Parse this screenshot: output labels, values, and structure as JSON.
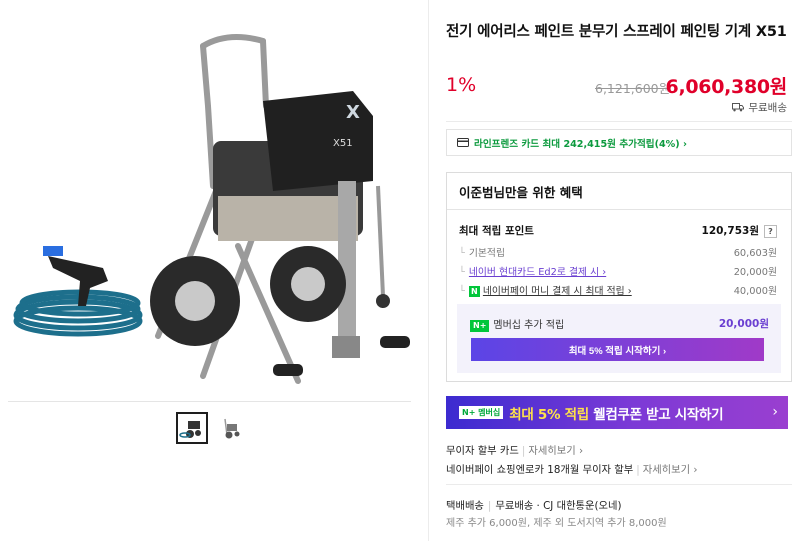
{
  "product": {
    "title": "전기 에어리스 페인트 분무기 스프레이 페인팅 기계 X51",
    "model_badge": "X51",
    "discount": "1%",
    "original_price": "6,121,600원",
    "sale_price": "6,060,380원",
    "shipping_tag": "무료배송"
  },
  "card_promo": {
    "text": "라인프렌즈 카드 최대 242,415원 추가적립(4%) ›"
  },
  "benefits": {
    "heading": "이준범님만을 위한 혜택",
    "max_label": "최대 적립 포인트",
    "max_value": "120,753원",
    "help": "?",
    "rows": [
      {
        "label": "기본적립",
        "value": "60,603원"
      },
      {
        "label": "네이버 현대카드 Ed2로 결제 시 ›",
        "value": "20,000원"
      },
      {
        "label": "네이버페이 머니 결제 시 최대 적립 ›",
        "value": "40,000원",
        "badge": "N"
      }
    ],
    "membership": {
      "badge": "N+",
      "label": "멤버십 추가 적립",
      "value": "20,000원",
      "button": "최대 5% 적립 시작하기 ›"
    }
  },
  "banner": {
    "badge": "N+ 멤버십",
    "text_highlight": "최대 5% 적립",
    "text_rest": " 웰컴쿠폰 받고 시작하기",
    "chevron": "›"
  },
  "payment": {
    "line1_label": "무이자 할부 카드",
    "line1_more": "자세히보기 ›",
    "line2_label": "네이버페이 쇼핑엔로카 18개월 무이자 할부",
    "line2_more": "자세히보기 ›"
  },
  "delivery": {
    "type": "택배배송",
    "fee": "무료배송 · CJ 대한통운(오네)",
    "extra": "제주 추가 6,000원, 제주 외 도서지역 추가 8,000원"
  },
  "colors": {
    "accent_red": "#e0002a",
    "green": "#00c63a",
    "purple": "#6a3fd1"
  },
  "icons": {
    "card": "credit-card-icon",
    "truck": "truck-icon"
  }
}
